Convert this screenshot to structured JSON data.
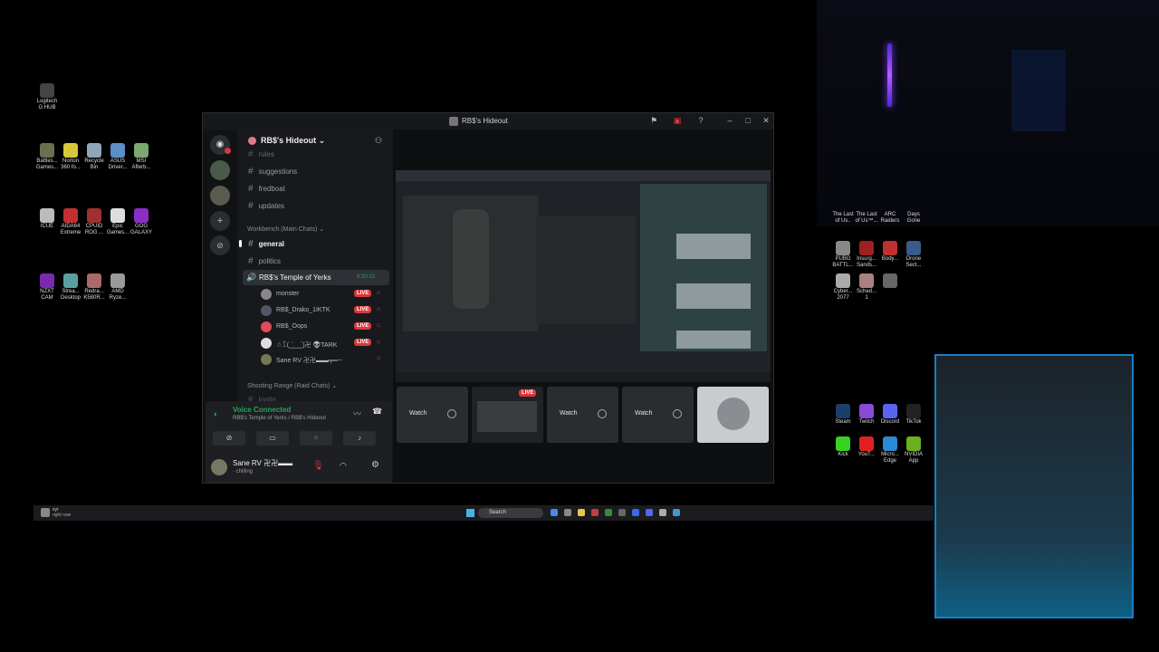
{
  "desktop_icons_left": [
    {
      "label": "Logitech\nG HUB",
      "color": "#444"
    },
    {
      "label": "Battles...\nGames...",
      "color": "#6a6f52"
    },
    {
      "label": "Norton\n360 fo...",
      "color": "#d6c83a"
    },
    {
      "label": "Recycle\nBin",
      "color": "#8fa6b8"
    },
    {
      "label": "ASUS\nDriver...",
      "color": "#5a8fc8"
    },
    {
      "label": "MSI\nAfterb...",
      "color": "#7aa870"
    },
    {
      "label": "ICUE",
      "color": "#bbb"
    },
    {
      "label": "AIDA64\nExtreme",
      "color": "#c03030"
    },
    {
      "label": "CPUID\nROG ...",
      "color": "#a03030"
    },
    {
      "label": "Epic\nGames...",
      "color": "#ddd"
    },
    {
      "label": "GOG\nGALAXY",
      "color": "#8a2ec8"
    },
    {
      "label": "NZXT\nCAM",
      "color": "#7a2ab0"
    },
    {
      "label": "Strea...\nDesktop",
      "color": "#5aa0a0"
    },
    {
      "label": "Redra...\nK580R...",
      "color": "#aa6a6a"
    },
    {
      "label": "AMD\nRyze...",
      "color": "#999"
    }
  ],
  "desktop_icons_right": [
    {
      "label": "The Last\nof Us..",
      "color": "#555"
    },
    {
      "label": "The Last\nof Us™...",
      "color": "#555"
    },
    {
      "label": "ARC\nRaiders",
      "color": "#555"
    },
    {
      "label": "Days\nGone",
      "color": "#555"
    },
    {
      "label": "PUBG\nBATTL...",
      "color": "#888"
    },
    {
      "label": "Insurg...\nSands...",
      "color": "#a02020"
    },
    {
      "label": "Body...",
      "color": "#c03030"
    },
    {
      "label": "Drone\nSect...",
      "color": "#3a5a8a"
    },
    {
      "label": "Cyber...\n2077",
      "color": "#aaa"
    },
    {
      "label": "Sched...\n1",
      "color": "#aa8080"
    },
    {
      "label": "",
      "color": "#666"
    },
    {
      "label": "Steam",
      "color": "#1b3f6a"
    },
    {
      "label": "Twitch",
      "color": "#8a4ad8"
    },
    {
      "label": "Discord",
      "color": "#5865f2"
    },
    {
      "label": "TikTok",
      "color": "#222"
    },
    {
      "label": "Kick",
      "color": "#3ad020"
    },
    {
      "label": "YouT...",
      "color": "#e02020"
    },
    {
      "label": "Micro...\nEdge",
      "color": "#2a8ad8"
    },
    {
      "label": "NVIDIA\nApp",
      "color": "#6ab020"
    }
  ],
  "window": {
    "title": "RB$'s Hideout",
    "server_name": "RB$'s Hideout"
  },
  "channels": {
    "top_partial": "rules",
    "items": [
      "suggestions",
      "fredboat",
      "updates"
    ],
    "category1": "Workbench (Main Chats)",
    "cat1_items": [
      "general",
      "politics"
    ],
    "voice_channel": "RB$'s Temple of Yerks",
    "voice_timer": "8:20:13",
    "voice_users": [
      {
        "name": "monster",
        "live": "LIVE",
        "color": "#888"
      },
      {
        "name": "RB$_Drako_1IKTK",
        "live": "LIVE",
        "color": "#556"
      },
      {
        "name": "RB$_Oops",
        "live": "LIVE",
        "color": "#e04a5a"
      },
      {
        "name": "☆ꀤ(‿̀_‿́)卍 👽TARK",
        "live": "LIVE",
        "color": "#ddd"
      },
      {
        "name": "Sane RV 卍卍▬▬╤═─",
        "live": "",
        "color": "#775"
      }
    ],
    "category2": "Shooting Range (Raid Chats)",
    "category2_partial": "lootin..."
  },
  "voice_panel": {
    "status": "Voice Connected",
    "channel_path": "RB$'s Temple of Yerks / RB$'s Hideout"
  },
  "user_panel": {
    "username": "Sane RV 卍卍▬▬",
    "status": "chilling"
  },
  "stream_tiles": [
    {
      "label": "Watch",
      "type": "watch"
    },
    {
      "label": "LIVE",
      "type": "live"
    },
    {
      "label": "Watch",
      "type": "watch"
    },
    {
      "label": "Watch",
      "type": "watch"
    },
    {
      "label": "",
      "type": "image"
    }
  ],
  "taskbar": {
    "search_placeholder": "Search",
    "tray_left_title": "syr",
    "tray_left_sub": "right now"
  },
  "colors": {
    "accent": "#5865f2",
    "live": "#da373c",
    "voice_green": "#23a55a"
  }
}
